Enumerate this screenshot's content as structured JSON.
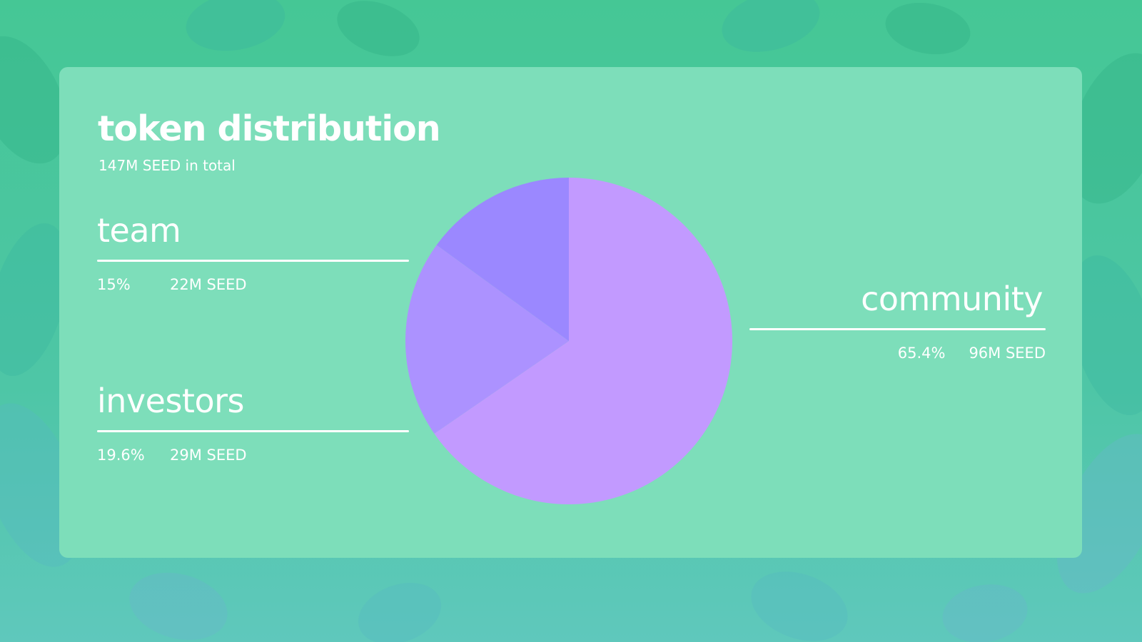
{
  "colors": {
    "card": "#7ddeba",
    "text": "#ffffff",
    "community_slice": "#c29aff",
    "investors_slice": "#ac92ff",
    "team_slice": "#9b88ff"
  },
  "header": {
    "title": "token distribution",
    "subtitle": "147M SEED in total"
  },
  "legend": {
    "team": {
      "label": "team",
      "percent": "15%",
      "amount": "22M SEED"
    },
    "investors": {
      "label": "investors",
      "percent": "19.6%",
      "amount": "29M SEED"
    },
    "community": {
      "label": "community",
      "percent": "65.4%",
      "amount": "96M SEED"
    }
  },
  "chart_data": {
    "type": "pie",
    "start_angle_deg": 0,
    "direction": "clockwise",
    "slices": [
      {
        "name": "community",
        "value": 65.4,
        "color": "#c29aff"
      },
      {
        "name": "investors",
        "value": 19.6,
        "color": "#ac92ff"
      },
      {
        "name": "team",
        "value": 15,
        "color": "#9b88ff"
      }
    ]
  }
}
